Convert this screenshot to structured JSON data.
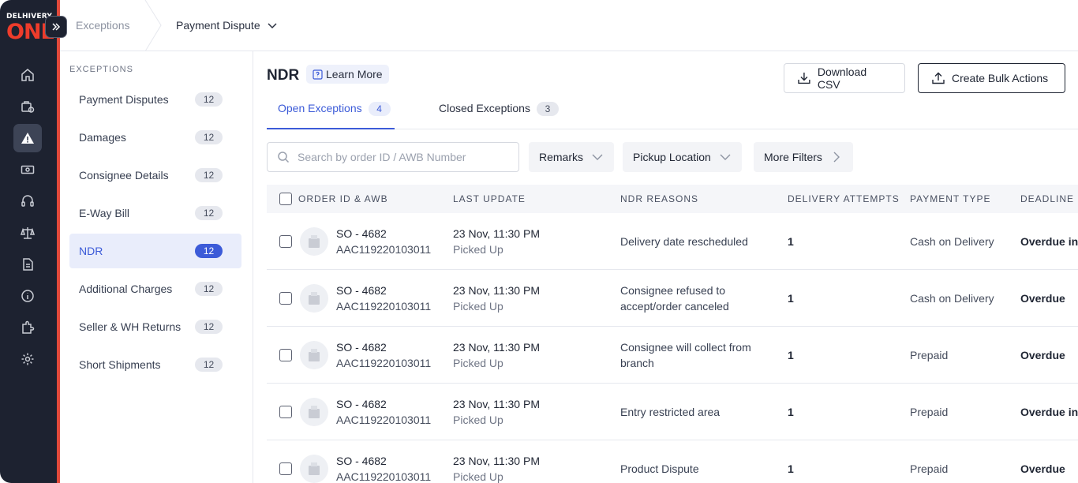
{
  "brand": {
    "logo_top": "DELHIVERY",
    "logo_main": "ONE",
    "accent_color": "#e24a3b",
    "logo_color": "#ee3c2b"
  },
  "rail": {
    "icons": [
      "home-icon",
      "orders-icon",
      "exceptions-icon",
      "payments-icon",
      "support-icon",
      "weight-icon",
      "document-icon",
      "info-icon",
      "integrations-icon",
      "settings-icon"
    ],
    "active": "exceptions-icon"
  },
  "breadcrumb": {
    "parent": "Exceptions",
    "current": "Payment Dispute"
  },
  "side_menu": {
    "heading": "EXCEPTIONS",
    "items": [
      {
        "label": "Payment Disputes",
        "count": "12"
      },
      {
        "label": "Damages",
        "count": "12"
      },
      {
        "label": "Consignee Details",
        "count": "12"
      },
      {
        "label": "E-Way Bill",
        "count": "12"
      },
      {
        "label": "NDR",
        "count": "12",
        "active": true
      },
      {
        "label": "Additional Charges",
        "count": "12"
      },
      {
        "label": "Seller & WH Returns",
        "count": "12"
      },
      {
        "label": "Short Shipments",
        "count": "12"
      }
    ]
  },
  "page": {
    "title": "NDR",
    "learn_more": "Learn More",
    "download_csv": "Download CSV",
    "bulk_actions": "Create Bulk Actions"
  },
  "tabs": [
    {
      "label": "Open Exceptions",
      "count": "4",
      "active": true
    },
    {
      "label": "Closed Exceptions",
      "count": "3"
    }
  ],
  "search": {
    "placeholder": "Search by order ID / AWB Number",
    "value": ""
  },
  "filters": {
    "remarks": "Remarks",
    "pickup": "Pickup Location",
    "more": "More Filters"
  },
  "table": {
    "columns": [
      "ORDER ID & AWB",
      "LAST UPDATE",
      "NDR REASONS",
      "DELIVERY ATTEMPTS",
      "PAYMENT TYPE",
      "DEADLINE"
    ],
    "rows": [
      {
        "order_id": "SO - 4682",
        "awb": "AAC119220103011",
        "update_time": "23 Nov, 11:30 PM",
        "update_status": "Picked Up",
        "reason": "Delivery date rescheduled",
        "attempts": "1",
        "payment": "Cash on Delivery",
        "deadline": "Overdue in"
      },
      {
        "order_id": "SO - 4682",
        "awb": "AAC119220103011",
        "update_time": "23 Nov, 11:30 PM",
        "update_status": "Picked Up",
        "reason": "Consignee refused to accept/order canceled",
        "attempts": "1",
        "payment": "Cash on Delivery",
        "deadline": "Overdue"
      },
      {
        "order_id": "SO - 4682",
        "awb": "AAC119220103011",
        "update_time": "23 Nov, 11:30 PM",
        "update_status": "Picked Up",
        "reason": "Consignee will collect from branch",
        "attempts": "1",
        "payment": "Prepaid",
        "deadline": "Overdue"
      },
      {
        "order_id": "SO - 4682",
        "awb": "AAC119220103011",
        "update_time": "23 Nov, 11:30 PM",
        "update_status": "Picked Up",
        "reason": "Entry restricted area",
        "attempts": "1",
        "payment": "Prepaid",
        "deadline": "Overdue in"
      },
      {
        "order_id": "SO - 4682",
        "awb": "AAC119220103011",
        "update_time": "23 Nov, 11:30 PM",
        "update_status": "Picked Up",
        "reason": "Product Dispute",
        "attempts": "1",
        "payment": "Prepaid",
        "deadline": "Overdue"
      }
    ]
  }
}
